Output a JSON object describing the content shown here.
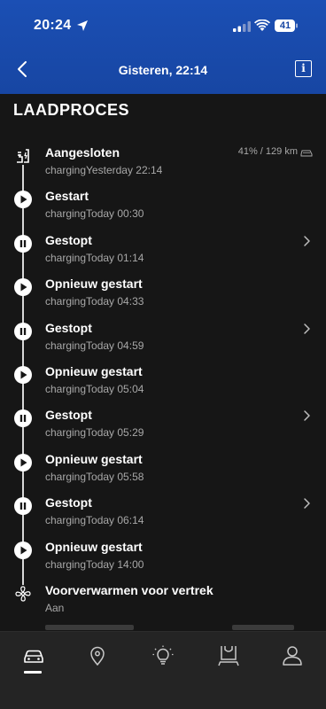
{
  "status_bar": {
    "time": "20:24",
    "battery": "41",
    "icons": [
      "location-arrow-icon",
      "signal-icon",
      "wifi-icon",
      "battery-icon"
    ]
  },
  "nav": {
    "title": "Gisteren, 22:14",
    "back_icon": "chevron-left-icon",
    "info_label": "i"
  },
  "section": {
    "title": "LAADPROCES"
  },
  "events": [
    {
      "title": "Aangesloten",
      "subtitle": "chargingYesterday 22:14",
      "icon": "plug-icon",
      "right": "41% / 129 km",
      "chevron": false
    },
    {
      "title": "Gestart",
      "subtitle": "chargingToday 00:30",
      "icon": "play-icon",
      "chevron": false
    },
    {
      "title": "Gestopt",
      "subtitle": "chargingToday 01:14",
      "icon": "pause-icon",
      "chevron": true
    },
    {
      "title": "Opnieuw gestart",
      "subtitle": "chargingToday 04:33",
      "icon": "play-icon",
      "chevron": false
    },
    {
      "title": "Gestopt",
      "subtitle": "chargingToday 04:59",
      "icon": "pause-icon",
      "chevron": true
    },
    {
      "title": "Opnieuw gestart",
      "subtitle": "chargingToday 05:04",
      "icon": "play-icon",
      "chevron": false
    },
    {
      "title": "Gestopt",
      "subtitle": "chargingToday 05:29",
      "icon": "pause-icon",
      "chevron": true
    },
    {
      "title": "Opnieuw gestart",
      "subtitle": "chargingToday 05:58",
      "icon": "play-icon",
      "chevron": false
    },
    {
      "title": "Gestopt",
      "subtitle": "chargingToday 06:14",
      "icon": "pause-icon",
      "chevron": true
    },
    {
      "title": "Opnieuw gestart",
      "subtitle": "chargingToday 14:00",
      "icon": "play-icon",
      "chevron": false
    },
    {
      "title": "Voorverwarmen voor vertrek",
      "subtitle": "Aan",
      "icon": "fan-icon",
      "chevron": false
    }
  ],
  "tabbar": {
    "tabs": [
      {
        "icon": "car-icon",
        "active": true
      },
      {
        "icon": "location-pin-icon",
        "active": false
      },
      {
        "icon": "lightbulb-icon",
        "active": false
      },
      {
        "icon": "shop-icon",
        "active": false
      },
      {
        "icon": "profile-icon",
        "active": false
      }
    ]
  },
  "colors": {
    "header": "#1746a3",
    "background": "#161616",
    "tabbar": "#242424",
    "subtext": "#a8a8a8"
  }
}
